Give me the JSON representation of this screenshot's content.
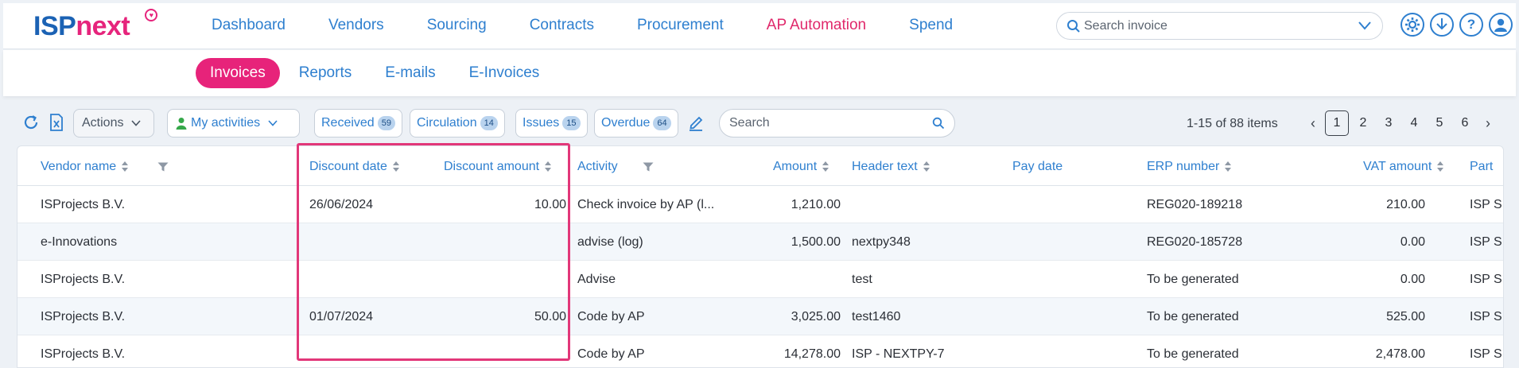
{
  "brand": {
    "part1": "ISP",
    "part2": "next",
    "mark": "♥"
  },
  "mainnav": [
    {
      "label": "Dashboard"
    },
    {
      "label": "Vendors"
    },
    {
      "label": "Sourcing"
    },
    {
      "label": "Contracts"
    },
    {
      "label": "Procurement"
    },
    {
      "label": "AP Automation"
    },
    {
      "label": "Spend"
    }
  ],
  "active_nav_color": "#e0286b",
  "top_search": {
    "placeholder": "Search invoice"
  },
  "top_icons": [
    "gear-icon",
    "download-icon",
    "help-icon",
    "user-icon"
  ],
  "subnav": [
    {
      "label": "Invoices"
    },
    {
      "label": "Reports"
    },
    {
      "label": "E-mails"
    },
    {
      "label": "E-Invoices"
    }
  ],
  "toolbar": {
    "actions_label": "Actions",
    "activities_label": "My activities",
    "filters": [
      {
        "label": "Received",
        "count": "59"
      },
      {
        "label": "Circulation",
        "count": "14"
      },
      {
        "label": "Issues",
        "count": "15"
      },
      {
        "label": "Overdue",
        "count": "64"
      }
    ],
    "search_placeholder": "Search",
    "items_text": "1-15 of 88 items",
    "pages": [
      "1",
      "2",
      "3",
      "4",
      "5",
      "6"
    ],
    "current_page": "1"
  },
  "table": {
    "columns": {
      "vendor": "Vendor name",
      "discount_date": "Discount date",
      "discount_amount": "Discount amount",
      "activity": "Activity",
      "amount": "Amount",
      "header_text": "Header text",
      "pay_date": "Pay date",
      "erp_number": "ERP number",
      "vat_amount": "VAT amount",
      "party": "Part"
    },
    "rows": [
      {
        "vendor": "ISProjects B.V.",
        "discount_date": "26/06/2024",
        "discount_amount": "10.00",
        "activity": "Check invoice by AP (l...",
        "amount": "1,210.00",
        "header_text": "",
        "pay_date": "",
        "erp_number": "REG020-189218",
        "vat_amount": "210.00",
        "party": "ISP S"
      },
      {
        "vendor": "e-Innovations",
        "discount_date": "",
        "discount_amount": "",
        "activity": "advise (log)",
        "amount": "1,500.00",
        "header_text": "nextpy348",
        "pay_date": "",
        "erp_number": "REG020-185728",
        "vat_amount": "0.00",
        "party": "ISP S"
      },
      {
        "vendor": "ISProjects B.V.",
        "discount_date": "",
        "discount_amount": "",
        "activity": "Advise",
        "amount": "",
        "header_text": "test",
        "pay_date": "",
        "erp_number": "To be generated",
        "vat_amount": "0.00",
        "party": "ISP S"
      },
      {
        "vendor": "ISProjects B.V.",
        "discount_date": "01/07/2024",
        "discount_amount": "50.00",
        "activity": "Code by AP",
        "amount": "3,025.00",
        "header_text": "test1460",
        "pay_date": "",
        "erp_number": "To be generated",
        "vat_amount": "525.00",
        "party": "ISP S"
      },
      {
        "vendor": "ISProjects B.V.",
        "discount_date": "",
        "discount_amount": "",
        "activity": "Code by AP",
        "amount": "14,278.00",
        "header_text": "ISP - NEXTPY-7",
        "pay_date": "",
        "erp_number": "To be generated",
        "vat_amount": "2,478.00",
        "party": "ISP S"
      }
    ]
  },
  "highlight_color": "#e23779"
}
